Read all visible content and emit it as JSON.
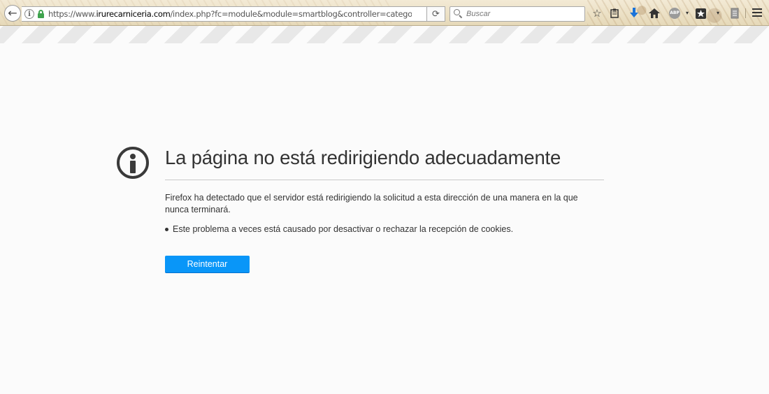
{
  "toolbar": {
    "back_icon": "←",
    "url_scheme": "https://www.",
    "url_host": "irurecarniceria.com",
    "url_path": "/index.php?fc=module&module=smartblog&controller=category?fc=modu",
    "reload_icon": "⟳",
    "search_placeholder": "Buscar",
    "icons": [
      "back-arrow-icon",
      "info-icon",
      "lock-icon",
      "reload-icon",
      "search-icon",
      "bookmark-star-icon",
      "reading-list-icon",
      "download-icon",
      "home-icon",
      "adblock-plus-icon",
      "bookmark-star-menu-icon",
      "dropdown-icon",
      "extension-icon",
      "hamburger-menu-icon"
    ],
    "abp_label": "ABP",
    "lock_color": "#3fa34d",
    "download_color": "#1a73d9"
  },
  "error": {
    "title": "La página no está redirigiendo adecuadamente",
    "description": "Firefox ha detectado que el servidor está redirigiendo la solicitud a esta dirección de una manera en la que nunca terminará.",
    "bullets": [
      "Este problema a veces está causado por desactivar o rechazar la recepción de cookies."
    ],
    "retry_label": "Reintentar",
    "button_color": "#0996f8"
  }
}
